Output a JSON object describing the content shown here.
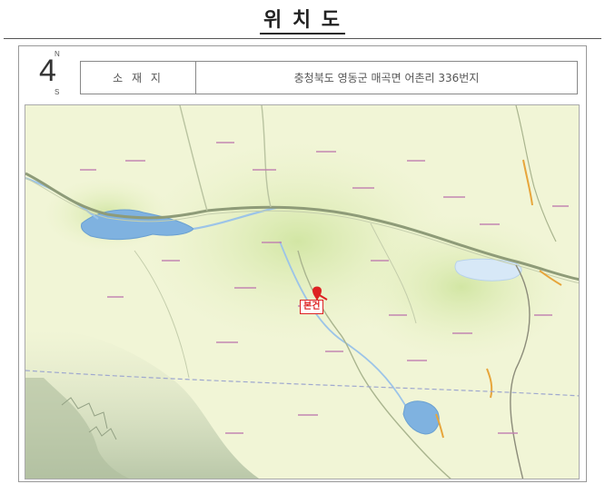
{
  "title": "위  치  도",
  "compass": {
    "north": "N",
    "south": "S",
    "glyph": "4"
  },
  "location": {
    "label": "소 재 지",
    "address": "충청북도 영동군 매곡면 어촌리 336번지"
  },
  "marker": {
    "label": "본건",
    "icon": "map-pin-icon",
    "color": "#dd2222"
  },
  "colors": {
    "land": "#f3f6d8",
    "urban": "#dcebb4",
    "mountain": "#c9d6b9",
    "water": "#7fb2e0",
    "road": "#9aa884",
    "border": "#9fa8cf"
  }
}
